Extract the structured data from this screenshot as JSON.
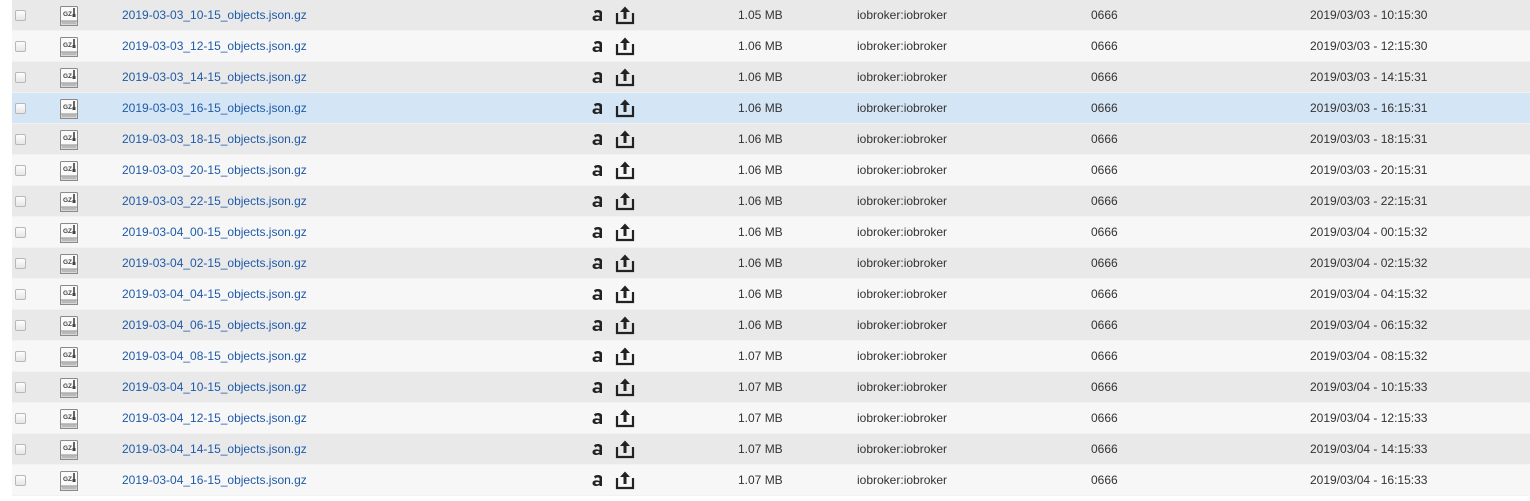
{
  "file_list": {
    "rows": [
      {
        "name": "2019-03-03_10-15_objects.json.gz",
        "size": "1.05 MB",
        "owner": "iobroker:iobroker",
        "mode": "0666",
        "date": "2019/03/03 - 10:15:30",
        "highlighted": false
      },
      {
        "name": "2019-03-03_12-15_objects.json.gz",
        "size": "1.06 MB",
        "owner": "iobroker:iobroker",
        "mode": "0666",
        "date": "2019/03/03 - 12:15:30",
        "highlighted": false
      },
      {
        "name": "2019-03-03_14-15_objects.json.gz",
        "size": "1.06 MB",
        "owner": "iobroker:iobroker",
        "mode": "0666",
        "date": "2019/03/03 - 14:15:31",
        "highlighted": false
      },
      {
        "name": "2019-03-03_16-15_objects.json.gz",
        "size": "1.06 MB",
        "owner": "iobroker:iobroker",
        "mode": "0666",
        "date": "2019/03/03 - 16:15:31",
        "highlighted": true
      },
      {
        "name": "2019-03-03_18-15_objects.json.gz",
        "size": "1.06 MB",
        "owner": "iobroker:iobroker",
        "mode": "0666",
        "date": "2019/03/03 - 18:15:31",
        "highlighted": false
      },
      {
        "name": "2019-03-03_20-15_objects.json.gz",
        "size": "1.06 MB",
        "owner": "iobroker:iobroker",
        "mode": "0666",
        "date": "2019/03/03 - 20:15:31",
        "highlighted": false
      },
      {
        "name": "2019-03-03_22-15_objects.json.gz",
        "size": "1.06 MB",
        "owner": "iobroker:iobroker",
        "mode": "0666",
        "date": "2019/03/03 - 22:15:31",
        "highlighted": false
      },
      {
        "name": "2019-03-04_00-15_objects.json.gz",
        "size": "1.06 MB",
        "owner": "iobroker:iobroker",
        "mode": "0666",
        "date": "2019/03/04 - 00:15:32",
        "highlighted": false
      },
      {
        "name": "2019-03-04_02-15_objects.json.gz",
        "size": "1.06 MB",
        "owner": "iobroker:iobroker",
        "mode": "0666",
        "date": "2019/03/04 - 02:15:32",
        "highlighted": false
      },
      {
        "name": "2019-03-04_04-15_objects.json.gz",
        "size": "1.06 MB",
        "owner": "iobroker:iobroker",
        "mode": "0666",
        "date": "2019/03/04 - 04:15:32",
        "highlighted": false
      },
      {
        "name": "2019-03-04_06-15_objects.json.gz",
        "size": "1.06 MB",
        "owner": "iobroker:iobroker",
        "mode": "0666",
        "date": "2019/03/04 - 06:15:32",
        "highlighted": false
      },
      {
        "name": "2019-03-04_08-15_objects.json.gz",
        "size": "1.07 MB",
        "owner": "iobroker:iobroker",
        "mode": "0666",
        "date": "2019/03/04 - 08:15:32",
        "highlighted": false
      },
      {
        "name": "2019-03-04_10-15_objects.json.gz",
        "size": "1.07 MB",
        "owner": "iobroker:iobroker",
        "mode": "0666",
        "date": "2019/03/04 - 10:15:33",
        "highlighted": false
      },
      {
        "name": "2019-03-04_12-15_objects.json.gz",
        "size": "1.07 MB",
        "owner": "iobroker:iobroker",
        "mode": "0666",
        "date": "2019/03/04 - 12:15:33",
        "highlighted": false
      },
      {
        "name": "2019-03-04_14-15_objects.json.gz",
        "size": "1.07 MB",
        "owner": "iobroker:iobroker",
        "mode": "0666",
        "date": "2019/03/04 - 14:15:33",
        "highlighted": false
      },
      {
        "name": "2019-03-04_16-15_objects.json.gz",
        "size": "1.07 MB",
        "owner": "iobroker:iobroker",
        "mode": "0666",
        "date": "2019/03/04 - 16:15:33",
        "highlighted": false
      }
    ],
    "icons": {
      "file": "gz-archive-icon",
      "rename": "rename-icon",
      "download": "download-icon",
      "checkbox": "checkbox"
    },
    "colors": {
      "row_even": "#e9e9ea",
      "row_odd": "#f7f7f8",
      "row_highlight": "#d4e5f5",
      "link": "#1f5aa8"
    }
  }
}
